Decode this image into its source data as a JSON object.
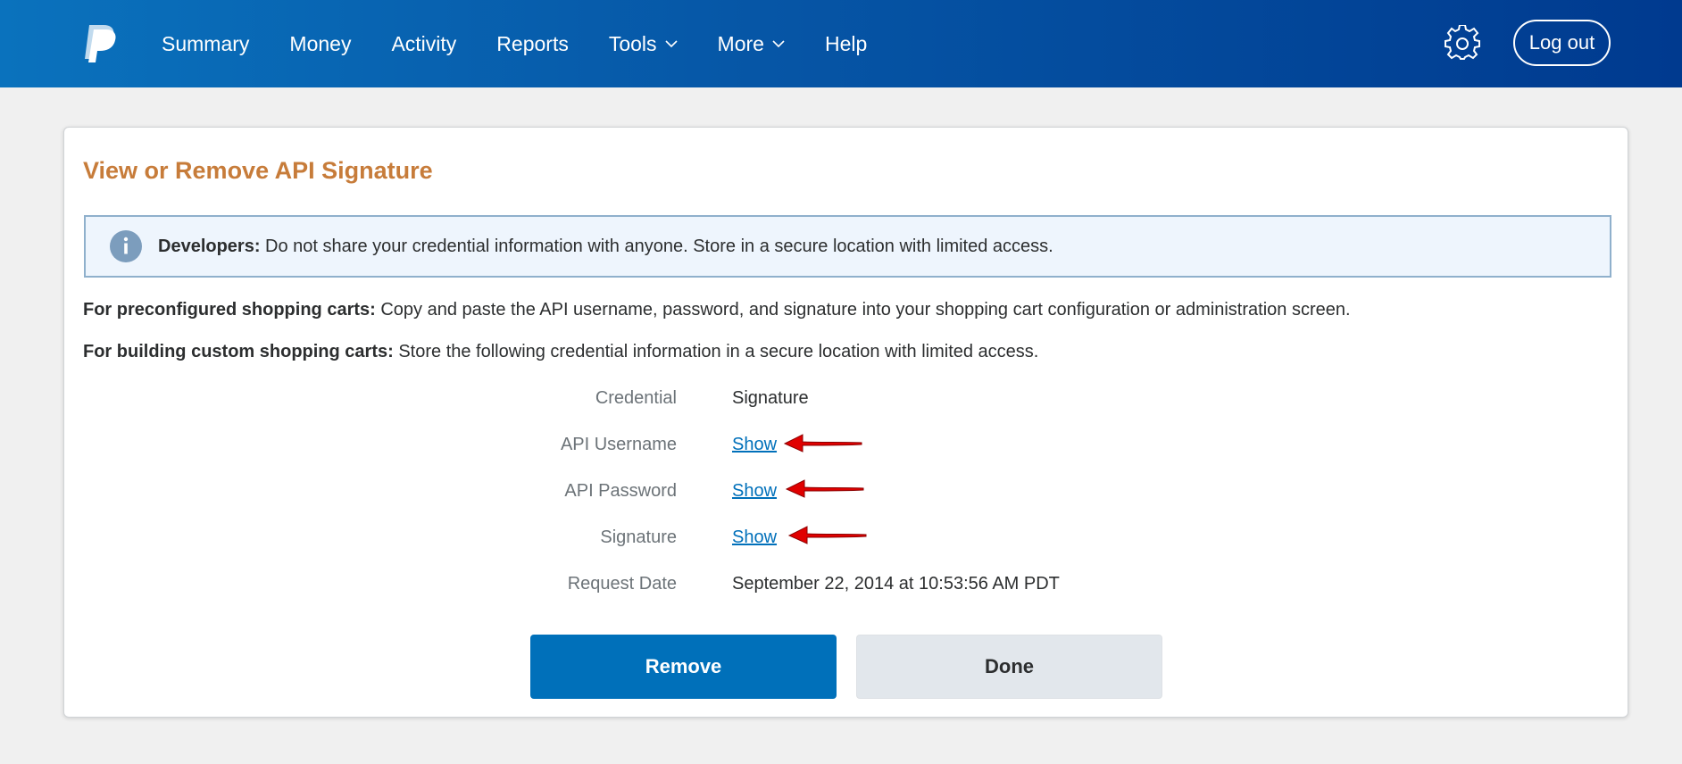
{
  "nav": {
    "items": [
      {
        "label": "Summary"
      },
      {
        "label": "Money"
      },
      {
        "label": "Activity"
      },
      {
        "label": "Reports"
      },
      {
        "label": "Tools"
      },
      {
        "label": "More"
      },
      {
        "label": "Help"
      }
    ],
    "logout_label": "Log out"
  },
  "page": {
    "title": "View or Remove API Signature",
    "notice": {
      "bold": "Developers:",
      "text": " Do not share your credential information with anyone. Store in a secure location with limited access."
    },
    "preconfigured": {
      "bold": "For preconfigured shopping carts:",
      "text": " Copy and paste the API username, password, and signature into your shopping cart configuration or administration screen."
    },
    "custom": {
      "bold": "For building custom shopping carts:",
      "text": " Store the following credential information in a secure location with limited access."
    },
    "credentials": {
      "credential_label": "Credential",
      "credential_value": "Signature",
      "username_label": "API Username",
      "username_value": "Show",
      "password_label": "API Password",
      "password_value": "Show",
      "signature_label": "Signature",
      "signature_value": "Show",
      "date_label": "Request Date",
      "date_value": "September 22, 2014 at 10:53:56 AM PDT"
    },
    "buttons": {
      "remove": "Remove",
      "done": "Done"
    }
  },
  "colors": {
    "brand_blue": "#0070ba",
    "title_orange": "#c77c3a",
    "annotation_red": "#e00000"
  }
}
